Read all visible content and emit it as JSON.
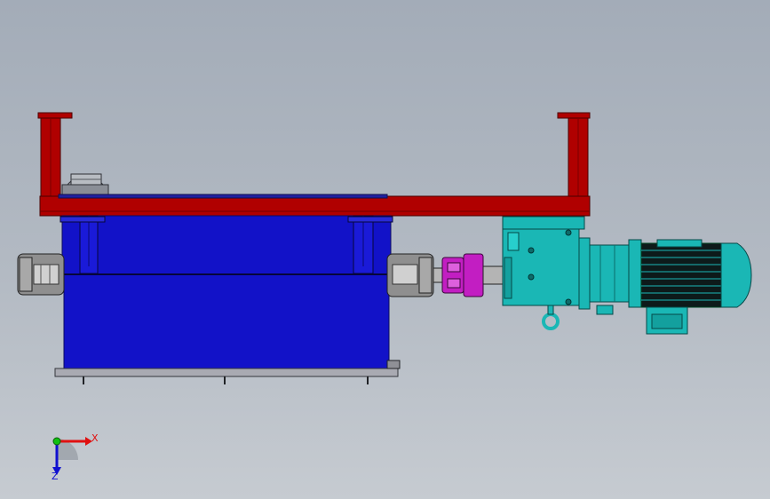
{
  "viewport": {
    "background_top": "#a3acb8",
    "background_bottom": "#c6cbd1"
  },
  "model": {
    "frame_color": "#b00000",
    "housing_color": "#1212c8",
    "coupling_color": "#c21ec2",
    "gearbox_color": "#1ab7b5",
    "shaft_color": "#8f8f8f",
    "base_color": "#a9aab2"
  },
  "triad": {
    "x_label": "X",
    "z_label": "Z",
    "x_color": "#e01010",
    "z_color": "#1010d0",
    "y_color": "#10c010"
  }
}
